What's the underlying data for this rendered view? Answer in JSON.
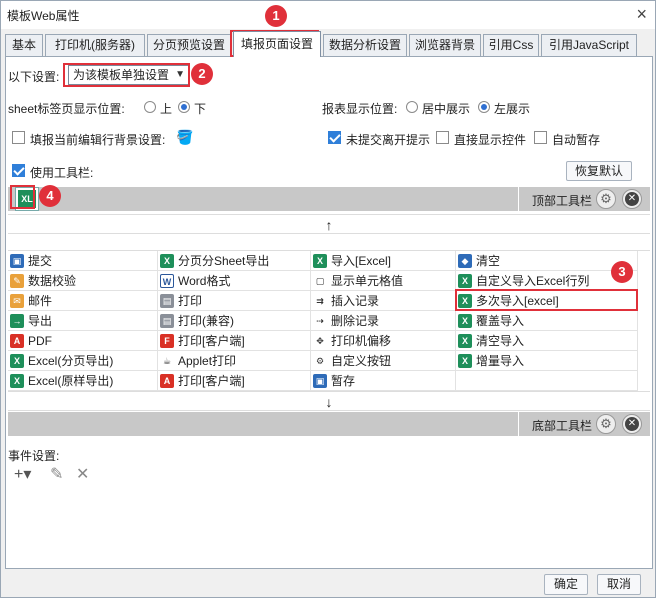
{
  "window": {
    "title": "模板Web属性",
    "close_icon": "×"
  },
  "tabs": [
    {
      "label": "基本"
    },
    {
      "label": "打印机(服务器)"
    },
    {
      "label": "分页预览设置"
    },
    {
      "label": "填报页面设置",
      "active": true
    },
    {
      "label": "数据分析设置"
    },
    {
      "label": "浏览器背景"
    },
    {
      "label": "引用Css"
    },
    {
      "label": "引用JavaScript"
    }
  ],
  "settings": {
    "scope_label": "以下设置:",
    "scope_value": "为该模板单独设置",
    "sheet_pos_label": "sheet标签页显示位置:",
    "sheet_top": "上",
    "sheet_bottom": "下",
    "report_pos_label": "报表显示位置:",
    "report_center": "居中展示",
    "report_left": "左展示",
    "fill_bg_label": "填报当前编辑行背景设置:",
    "unsubmitted_label": "未提交离开提示",
    "direct_show_label": "直接显示控件",
    "auto_save_label": "自动暂存",
    "use_toolbar_label": "使用工具栏:",
    "restore_default": "恢复默认"
  },
  "top_toolbar": {
    "label": "顶部工具栏",
    "up_arrow": "↑"
  },
  "bottom_toolbar": {
    "label": "底部工具栏",
    "down_arrow": "↓"
  },
  "button_grid": {
    "col1": [
      "提交",
      "数据校验",
      "邮件",
      "导出",
      "PDF",
      "Excel(分页导出)",
      "Excel(原样导出)"
    ],
    "col2": [
      "分页分Sheet导出",
      "Word格式",
      "打印",
      "打印(兼容)",
      "打印[客户端]",
      "Applet打印",
      "打印[客户端]"
    ],
    "col3": [
      "导入[Excel]",
      "显示单元格值",
      "插入记录",
      "删除记录",
      "打印机偏移",
      "自定义按钮",
      "暂存"
    ],
    "col4": [
      "清空",
      "自定义导入Excel行列",
      "多次导入[excel]",
      "覆盖导入",
      "清空导入",
      "增量导入",
      ""
    ]
  },
  "events": {
    "label": "事件设置:",
    "add_icon": "+▾",
    "edit_icon": "✎",
    "delete_icon": "✕"
  },
  "footer": {
    "ok": "确定",
    "cancel": "取消"
  },
  "annotations": {
    "n1": "1",
    "n2": "2",
    "n3": "3",
    "n4": "4"
  },
  "colors": {
    "accent": "#2f7fd9",
    "annotation_red": "#e0303a",
    "excel_green": "#1e8f5a"
  }
}
